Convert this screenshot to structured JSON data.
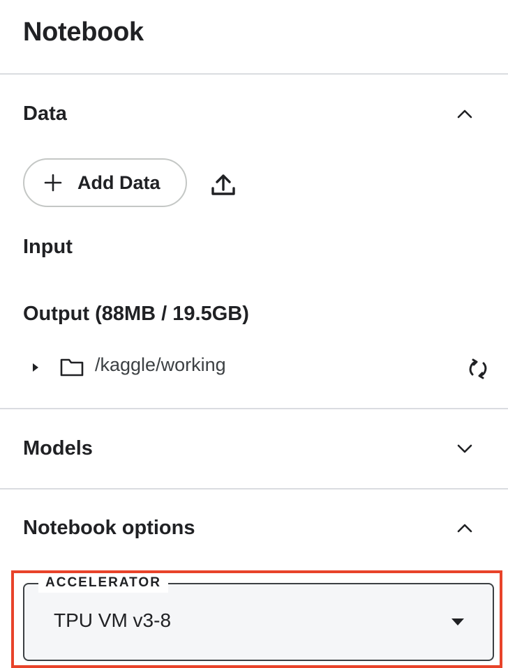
{
  "panel": {
    "title": "Notebook"
  },
  "sections": {
    "data": {
      "title": "Data",
      "expanded": true,
      "add_data_label": "Add Data",
      "input_heading": "Input",
      "output_heading": "Output (88MB / 19.5GB)",
      "output_tree": {
        "path": "/kaggle/working"
      }
    },
    "models": {
      "title": "Models",
      "expanded": false
    },
    "notebook_options": {
      "title": "Notebook options",
      "expanded": true,
      "accelerator": {
        "label": "ACCELERATOR",
        "value": "TPU VM v3-8"
      }
    }
  },
  "icons": {
    "collapse": "chevron-up-icon",
    "expand": "chevron-down-icon",
    "add": "plus-icon",
    "upload": "upload-icon",
    "folder": "folder-icon",
    "refresh": "refresh-icon",
    "caret": "caret-right-icon",
    "dropdown": "dropdown-arrow-icon"
  },
  "colors": {
    "highlight": "#e8432a",
    "divider": "#dadce0",
    "text": "#202124"
  }
}
